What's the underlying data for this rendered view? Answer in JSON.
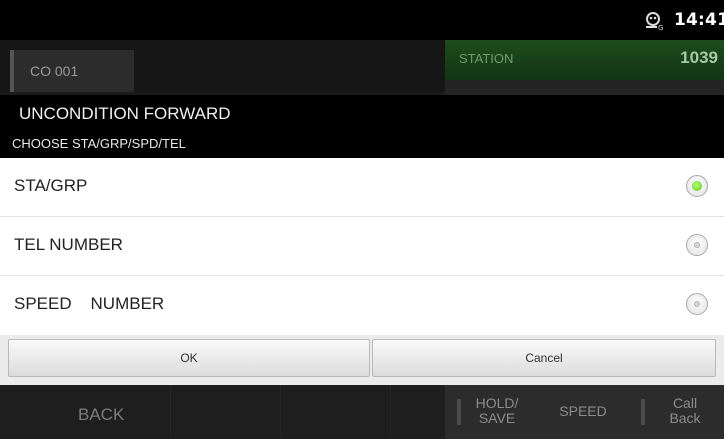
{
  "status_bar": {
    "time": "14:41",
    "icon": "android-debug-icon"
  },
  "background": {
    "co_label": "CO 001",
    "station_label": "STATION",
    "station_number": "1039",
    "bottom_bar": {
      "back": "BACK",
      "hold_save": "HOLD/\nSAVE",
      "speed": "SPEED",
      "call_back": "Call\nBack"
    }
  },
  "dialog": {
    "title": "UNCONDITION FORWARD",
    "subtitle": "CHOOSE STA/GRP/SPD/TEL",
    "options": [
      {
        "label": "STA/GRP",
        "selected": true
      },
      {
        "label": "TEL NUMBER",
        "selected": false
      },
      {
        "label": "SPEED    NUMBER",
        "selected": false
      }
    ],
    "ok_label": "OK",
    "cancel_label": "Cancel"
  },
  "colors": {
    "selected_radio": "#57c80c",
    "station_header": "#1d4d1d"
  }
}
